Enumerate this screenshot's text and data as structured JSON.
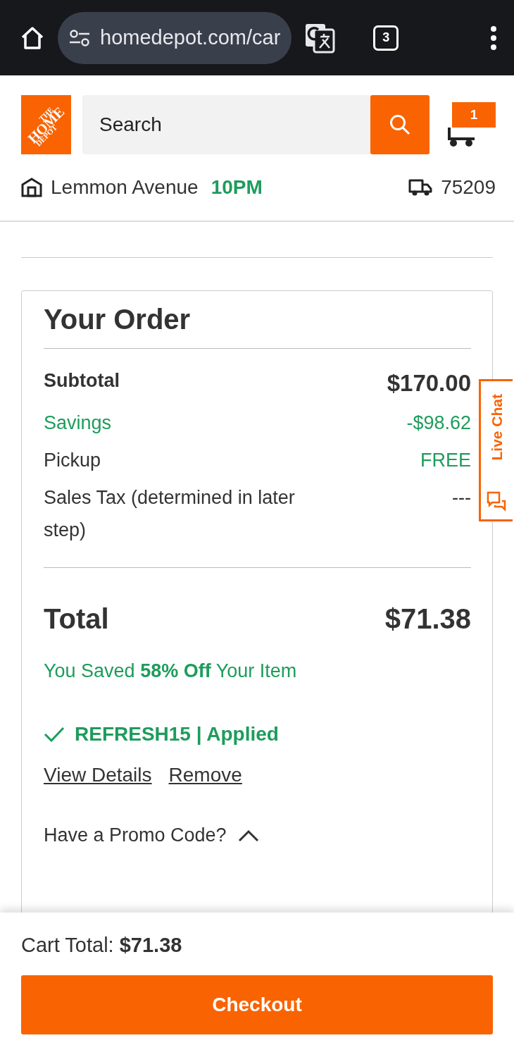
{
  "browser": {
    "url": "homedepot.com/car",
    "tab_count": "3"
  },
  "header": {
    "logo": [
      "THE",
      "HOME",
      "DEPOT"
    ],
    "search": {
      "placeholder": "Search"
    },
    "cart_count": "1",
    "store": "Lemmon Avenue",
    "store_hours": "10PM",
    "zip": "75209"
  },
  "order": {
    "title": "Your Order",
    "lines": [
      {
        "kind": "subtotal",
        "label": "Subtotal",
        "value": "$170.00"
      },
      {
        "kind": "savings",
        "label": "Savings",
        "value": "-$98.62"
      },
      {
        "kind": "free",
        "label": "Pickup",
        "value": "FREE"
      },
      {
        "kind": "pending",
        "label": "Sales Tax (determined in later step)",
        "value": "---"
      }
    ],
    "total_label": "Total",
    "total_value": "$71.38",
    "saved_message": "You Saved **58% Off** Your Item",
    "promo": {
      "applied_text": "REFRESH15 | Applied",
      "links": [
        "View Details",
        "Remove"
      ],
      "toggle_label": "Have a Promo Code?",
      "expanded": true
    }
  },
  "live_chat": "Live Chat",
  "footer": {
    "cart_total_label": "Cart Total:",
    "cart_total_value": "$71.38",
    "checkout": "Checkout"
  }
}
